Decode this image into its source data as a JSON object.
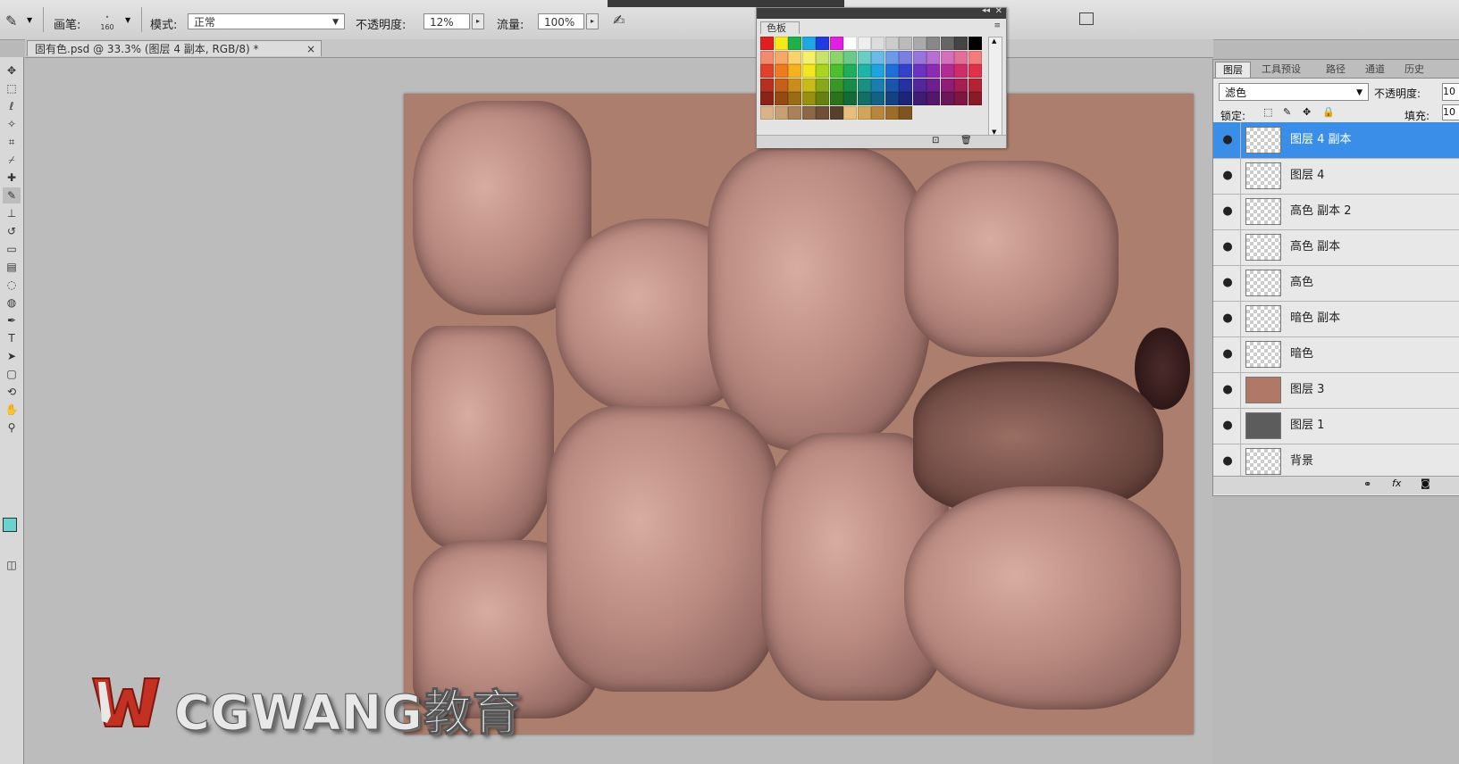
{
  "options_bar": {
    "brush_label": "画笔:",
    "brush_size": "160",
    "mode_label": "模式:",
    "mode_value": "正常",
    "opacity_label": "不透明度:",
    "opacity_value": "12%",
    "flow_label": "流量:",
    "flow_value": "100%"
  },
  "document": {
    "tab_title": "固有色.psd @ 33.3% (图层 4 副本, RGB/8) *",
    "close": "×"
  },
  "swatches_panel": {
    "tab": "色板",
    "colors": {
      "row1": [
        "#e11f1f",
        "#f7e81a",
        "#1fb04a",
        "#1fa7e1",
        "#1f3be1",
        "#e11fe1",
        "#ffffff",
        "#eeeeee",
        "#dddddd",
        "#cccccc",
        "#bbbbbb",
        "#aaaaaa",
        "#888888",
        "#666666",
        "#444444",
        "#000000"
      ],
      "row2": [
        "#f28b6e",
        "#f6a86b",
        "#f9d36b",
        "#f6f06b",
        "#c8e36b",
        "#8fd36b",
        "#6bc98a",
        "#6bcdc3",
        "#6bbbe8",
        "#6b9ae8",
        "#7b7fe0",
        "#9a75d9",
        "#b86fd3",
        "#d36fbd",
        "#e36f98",
        "#f27c7c"
      ],
      "row3": [
        "#e1402a",
        "#ef7a1f",
        "#f5b21f",
        "#f3e51f",
        "#a9d41f",
        "#4bbf2e",
        "#1fae5a",
        "#1fb5a6",
        "#1fa3de",
        "#1f6fd9",
        "#3442c9",
        "#6a34c0",
        "#8c2cb3",
        "#b32c96",
        "#d12c6a",
        "#e1304a"
      ],
      "row4": [
        "#b5301f",
        "#c4601a",
        "#c98d1a",
        "#c7bb1a",
        "#86a81a",
        "#3a9626",
        "#1a8a47",
        "#1a8f82",
        "#1a7fae",
        "#1a55ab",
        "#25319f",
        "#522799",
        "#6d1f8c",
        "#8c1f75",
        "#a31f52",
        "#b02436"
      ],
      "row5": [
        "#8a2416",
        "#964913",
        "#9a6c13",
        "#988f13",
        "#658013",
        "#2b721c",
        "#136a35",
        "#136e63",
        "#136185",
        "#134182",
        "#1c2579",
        "#3f1d75",
        "#53176b",
        "#6b175a",
        "#7d173f",
        "#871b29"
      ],
      "row6": [
        "#d9b48a",
        "#c79f74",
        "#a9825a",
        "#8b6848",
        "#6e5038",
        "#55402e",
        "#e6c07a",
        "#d1a55a",
        "#b8873e",
        "#9b6c2a",
        "#7d561f"
      ]
    }
  },
  "layers_panel": {
    "tabs": [
      "图层",
      "工具预设",
      "路径",
      "通道",
      "历史"
    ],
    "blend_mode": "滤色",
    "opacity_label": "不透明度:",
    "opacity_value": "10",
    "lock_label": "锁定:",
    "fill_label": "填充:",
    "fill_value": "10",
    "layers": [
      {
        "name": "图层 4 副本",
        "selected": true,
        "thumb_color": ""
      },
      {
        "name": "图层 4",
        "selected": false,
        "thumb_color": ""
      },
      {
        "name": "高色 副本 2",
        "selected": false,
        "thumb_color": ""
      },
      {
        "name": "高色 副本",
        "selected": false,
        "thumb_color": ""
      },
      {
        "name": "高色",
        "selected": false,
        "thumb_color": ""
      },
      {
        "name": "暗色 副本",
        "selected": false,
        "thumb_color": ""
      },
      {
        "name": "暗色",
        "selected": false,
        "thumb_color": ""
      },
      {
        "name": "图层 3",
        "selected": false,
        "thumb_color": "#b07866"
      },
      {
        "name": "图层 1",
        "selected": false,
        "thumb_color": "#5c5c5c"
      },
      {
        "name": "背景",
        "selected": false,
        "thumb_color": ""
      }
    ],
    "footer_icons": [
      "link-icon",
      "fx-icon",
      "mask-icon"
    ]
  },
  "watermark": {
    "text": "CGWANG教育",
    "logo_letter": "W"
  },
  "theme": {
    "selected_row": "#3b8ee8",
    "canvas_skin": "#ac7e6d"
  }
}
